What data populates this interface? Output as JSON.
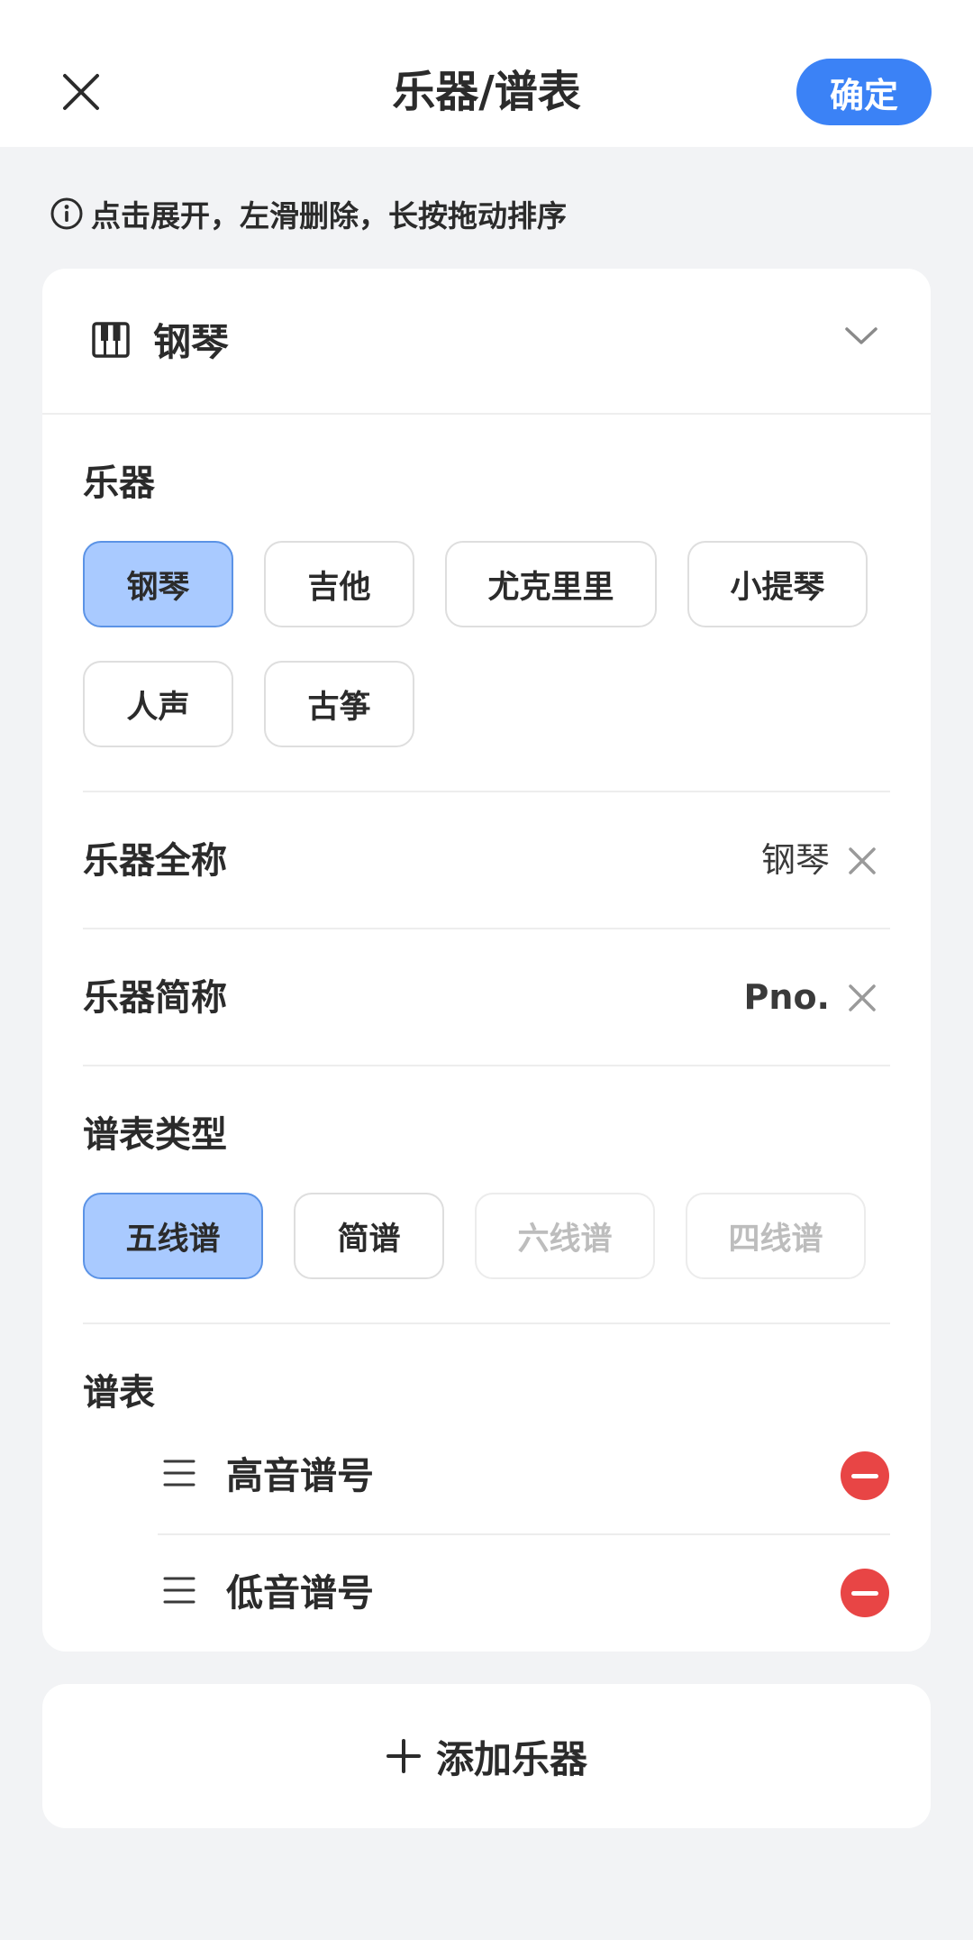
{
  "header": {
    "title": "乐器/谱表",
    "confirm_label": "确定"
  },
  "hint": "点击展开，左滑删除，长按拖动排序",
  "instrument_card": {
    "title": "钢琴",
    "instrument_section": {
      "label": "乐器",
      "options": [
        "钢琴",
        "吉他",
        "尤克里里",
        "小提琴",
        "人声",
        "古筝"
      ],
      "selected": "钢琴"
    },
    "full_name": {
      "label": "乐器全称",
      "value": "钢琴"
    },
    "short_name": {
      "label": "乐器简称",
      "value": "Pno."
    },
    "staff_type": {
      "label": "谱表类型",
      "options": [
        "五线谱",
        "简谱",
        "六线谱",
        "四线谱"
      ],
      "selected": "五线谱",
      "disabled": [
        "六线谱",
        "四线谱"
      ]
    },
    "staves": {
      "label": "谱表",
      "items": [
        "高音谱号",
        "低音谱号"
      ]
    }
  },
  "add_instrument_label": "添加乐器",
  "colors": {
    "accent": "#3b82f6",
    "chip_selected": "#a9caff",
    "remove": "#e84545",
    "background": "#f2f3f5"
  },
  "icons": [
    "close-icon",
    "info-icon",
    "piano-icon",
    "chevron-down-icon",
    "clear-icon",
    "drag-handle-icon",
    "minus-icon",
    "plus-icon"
  ]
}
